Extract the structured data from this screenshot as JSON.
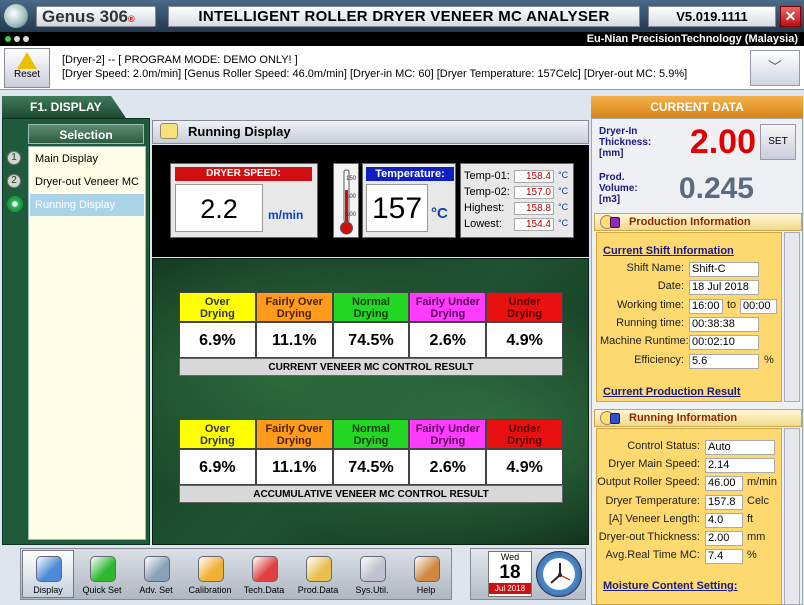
{
  "window": {
    "logo_text": "Genus 306",
    "logo_sub": "®",
    "title": "INTELLIGENT ROLLER DRYER VENEER MC ANALYSER",
    "version": "V5.019.1111",
    "close_glyph": "✕",
    "company": "Eu-Nian PrecisionTechnology  (Malaysia)",
    "dot_colors": [
      "#3bd33b",
      "#dddddd",
      "#dddddd"
    ]
  },
  "status": {
    "reset_label": "Reset",
    "line1": "[Dryer-2] -- [ PROGRAM MODE: DEMO ONLY! ]",
    "line2": "[Dryer Speed: 2.0m/min]  [Genus Roller Speed: 46.0m/min]  [Dryer-in MC: 60]  [Dryer Temperature: 157Celc]  [Dryer-out MC: 5.9%]",
    "collapse_glyph": "﹀"
  },
  "left": {
    "tab_label": "F1. DISPLAY",
    "selection_label": "Selection",
    "items": [
      {
        "num": "1",
        "label": "Main Display"
      },
      {
        "num": "2",
        "label": "Dryer-out Veneer MC"
      },
      {
        "num": "",
        "label": "Running Display"
      }
    ]
  },
  "running": {
    "title": "Running Display",
    "speed_label": "DRYER SPEED:",
    "speed_value": "2.2",
    "speed_unit": "m/min",
    "temp_label": "Temperature:",
    "temp_value": "157",
    "temp_unit": "°C",
    "therm_ticks": [
      "150",
      "100",
      "100"
    ],
    "temps": [
      {
        "label": "Temp-01:",
        "value": "158.4",
        "unit": "°C"
      },
      {
        "label": "Temp-02:",
        "value": "157.0",
        "unit": "°C"
      },
      {
        "label": "Highest:",
        "value": "158.8",
        "unit": "°C"
      },
      {
        "label": "Lowest:",
        "value": "154.4",
        "unit": "°C"
      }
    ]
  },
  "mc_categories": [
    {
      "line1": "Over",
      "line2": "Drying",
      "color": "#ffff00",
      "text": "#333333"
    },
    {
      "line1": "Fairly Over",
      "line2": "Drying",
      "color": "#ff9a1a",
      "text": "#4a2400"
    },
    {
      "line1": "Normal",
      "line2": "Drying",
      "color": "#22d822",
      "text": "#0b3a0b"
    },
    {
      "line1": "Fairly Under",
      "line2": "Drying",
      "color": "#ff3cff",
      "text": "#5a005a"
    },
    {
      "line1": "Under",
      "line2": "Drying",
      "color": "#e81010",
      "text": "#5a0000"
    }
  ],
  "current_result": {
    "values": [
      "6.9%",
      "11.1%",
      "74.5%",
      "2.6%",
      "4.9%"
    ],
    "caption": "CURRENT VENEER MC CONTROL RESULT"
  },
  "accum_result": {
    "values": [
      "6.9%",
      "11.1%",
      "74.5%",
      "2.6%",
      "4.9%"
    ],
    "caption": "ACCUMULATIVE VENEER MC CONTROL RESULT"
  },
  "right": {
    "tab_label": "CURRENT DATA",
    "thick_label_1": "Dryer-In",
    "thick_label_2": "Thickness:",
    "thick_label_3": "[mm]",
    "thick_value": "2.00",
    "set_label": "SET",
    "vol_label_1": "Prod.",
    "vol_label_2": "Volume:",
    "vol_label_3": "[m3]",
    "vol_value": "0.245",
    "prod_info_head": "Production Information",
    "shift_head": "Current Shift Information",
    "shift_fields": [
      {
        "label": "Shift Name:",
        "value": "Shift-C"
      },
      {
        "label": "Date:",
        "value": "18 Jul 2018"
      },
      {
        "label": "Working time:",
        "value": "16:00",
        "to": "to",
        "value2": "00:00"
      },
      {
        "label": "Running time:",
        "value": "00:38:38"
      },
      {
        "label": "Machine Runtime:",
        "value": "00:02:10"
      },
      {
        "label": "Efficiency:",
        "value": "5.6",
        "unit": "%"
      }
    ],
    "cur_prod_head": "Current Production Result",
    "run_info_head": "Running Information",
    "run_fields": [
      {
        "label": "Control Status:",
        "value": "Auto",
        "unit": ""
      },
      {
        "label": "Dryer Main Speed:",
        "value": "2.14",
        "unit": ""
      },
      {
        "label": "Output Roller Speed:",
        "value": "46.00",
        "unit": "m/min"
      },
      {
        "label": "Dryer Temperature:",
        "value": "157.8",
        "unit": "Celc"
      },
      {
        "label": "[A] Veneer Length:",
        "value": "4.0",
        "unit": "ft"
      },
      {
        "label": "Dryer-out Thickness:",
        "value": "2.00",
        "unit": "mm"
      },
      {
        "label": "Avg.Real Time MC:",
        "value": "7.4",
        "unit": "%"
      }
    ],
    "mc_setting_head": "Moisture Content Setting:"
  },
  "toolbar": [
    {
      "label": "Display",
      "icon": "monitor-icon",
      "color": "#4a8ad8"
    },
    {
      "label": "Quick Set",
      "icon": "quick-set-icon",
      "color": "#2fb82f"
    },
    {
      "label": "Adv. Set",
      "icon": "ruler-icon",
      "color": "#8aa0b8"
    },
    {
      "label": "Calibration",
      "icon": "calibration-icon",
      "color": "#f0b030"
    },
    {
      "label": "Tech.Data",
      "icon": "chart-icon",
      "color": "#e04040"
    },
    {
      "label": "Prod.Data",
      "icon": "document-icon",
      "color": "#e8c050"
    },
    {
      "label": "Sys.Util.",
      "icon": "disc-icon",
      "color": "#c0c0d0"
    },
    {
      "label": "Help",
      "icon": "help-icon",
      "color": "#d08840"
    }
  ],
  "calendar": {
    "weekday": "Wed",
    "day": "18",
    "month_year": "Jul 2018"
  }
}
